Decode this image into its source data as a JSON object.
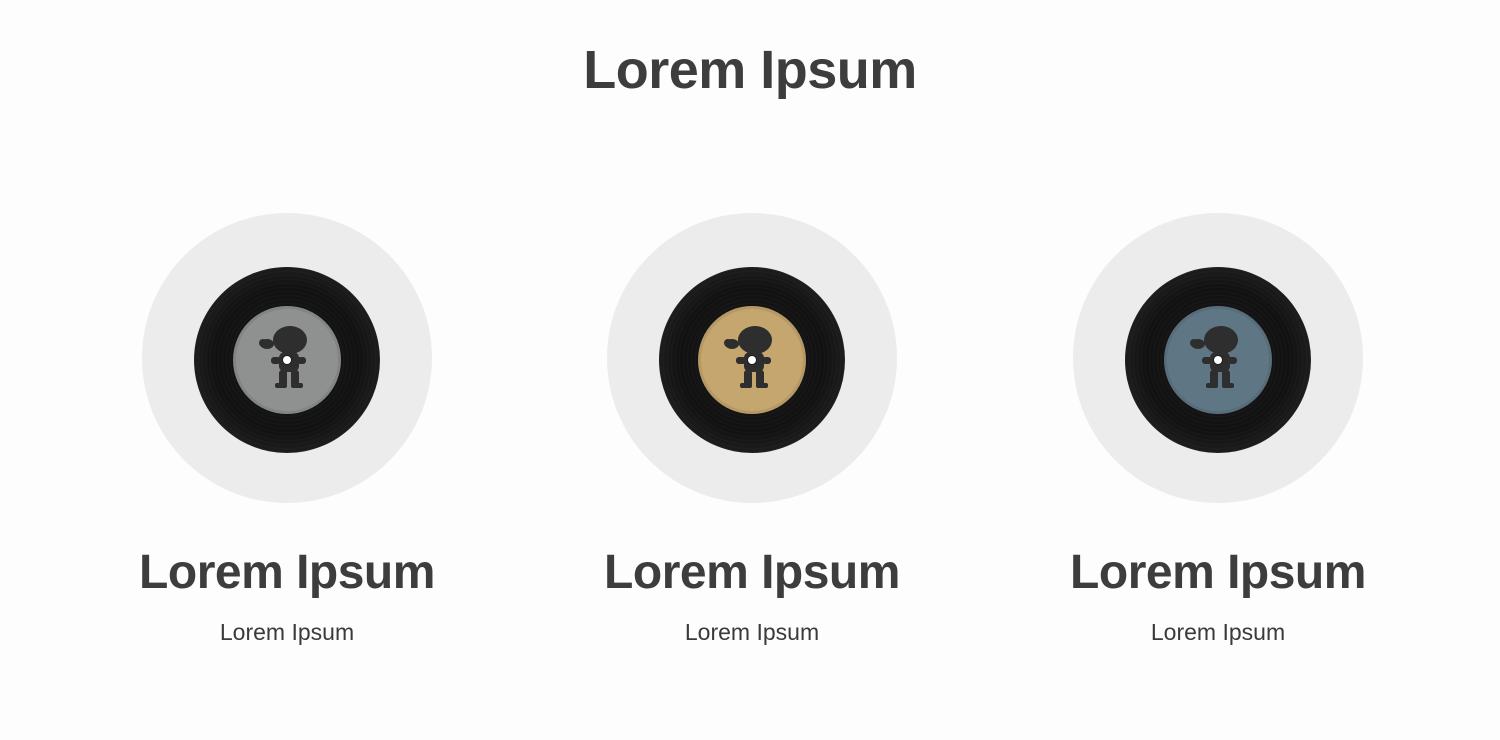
{
  "page": {
    "title": "Lorem Ipsum",
    "background": "#fdfdfd",
    "text_color": "#3d3d3d"
  },
  "cards": [
    {
      "title": "Lorem Ipsum",
      "subtitle": "Lorem Ipsum",
      "label_color": "#8e9190",
      "icon": "vinyl-record-icon"
    },
    {
      "title": "Lorem Ipsum",
      "subtitle": "Lorem Ipsum",
      "label_color": "#c4a66e",
      "icon": "vinyl-record-icon"
    },
    {
      "title": "Lorem Ipsum",
      "subtitle": "Lorem Ipsum",
      "label_color": "#5f7785",
      "icon": "vinyl-record-icon"
    }
  ]
}
